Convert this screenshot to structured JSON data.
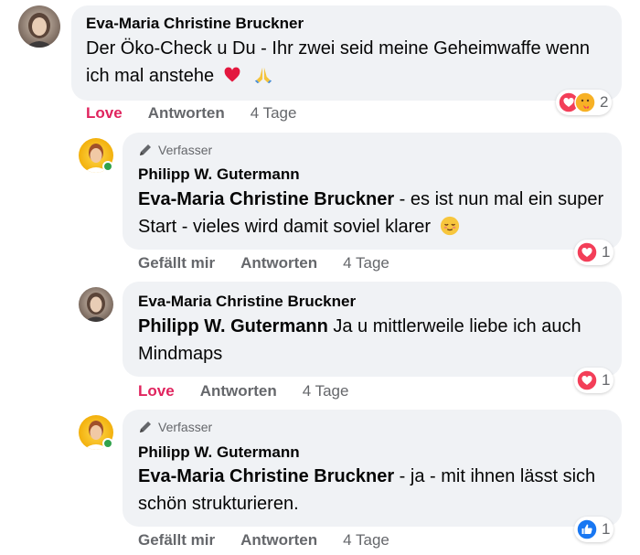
{
  "comments": [
    {
      "author": "Eva-Maria Christine Bruckner",
      "text": "Der Öko-Check u Du - Ihr zwei seid meine Geheimwaffe wenn ich mal anstehe",
      "emojis": "red-heart, folded-hands",
      "like_action": "Love",
      "reply_action": "Antworten",
      "time": "4 Tage",
      "reaction_count": "2",
      "reaction_types": "love, care"
    },
    {
      "badge": "Verfasser",
      "author": "Philipp W. Gutermann",
      "mention": "Eva-Maria Christine Bruckner",
      "text": " - es ist nun mal ein super Start - vieles wird damit soviel klarer",
      "emojis": "relieved-face",
      "like_action": "Gefällt mir",
      "reply_action": "Antworten",
      "time": "4 Tage",
      "reaction_count": "1",
      "reaction_types": "love"
    },
    {
      "author": "Eva-Maria Christine Bruckner",
      "mention": "Philipp W. Gutermann",
      "text": " Ja u mittlerweile liebe ich auch Mindmaps",
      "like_action": "Love",
      "reply_action": "Antworten",
      "time": "4 Tage",
      "reaction_count": "1",
      "reaction_types": "love"
    },
    {
      "badge": "Verfasser",
      "author": "Philipp W. Gutermann",
      "mention": "Eva-Maria Christine Bruckner",
      "text": " - ja - mit ihnen lässt sich schön strukturieren.",
      "like_action": "Gefällt mir",
      "reply_action": "Antworten",
      "time": "4 Tage",
      "reaction_count": "1",
      "reaction_types": "like"
    }
  ],
  "colors": {
    "love": "#e0245e",
    "bubble": "#f0f2f5",
    "secondary": "#65676b",
    "like_blue": "#1877f2",
    "online": "#31a24c"
  }
}
